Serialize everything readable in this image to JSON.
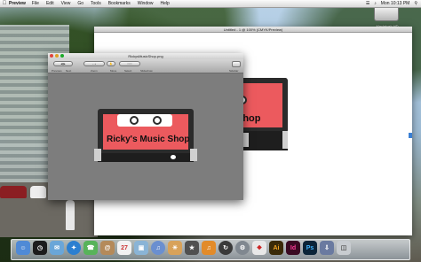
{
  "menubar": {
    "app": "Preview",
    "items": [
      "File",
      "Edit",
      "View",
      "Go",
      "Tools",
      "Bookmarks",
      "Window",
      "Help"
    ],
    "clock": "Mon 10:13 PM"
  },
  "desktop": {
    "icon_label": "Macintosh HD"
  },
  "back_window": {
    "title": "Untitled - 1 @ 100% (CMYK/Preview)"
  },
  "front_window": {
    "title": "RickysMusicShop.png",
    "toolbar": [
      "Previous",
      "Next",
      "Zoom",
      "Move",
      "Select",
      "Slideshow"
    ],
    "sidebar_label": "Sidebar"
  },
  "cassette": {
    "label": "Ricky's Music Shop",
    "label_partial": "Shop",
    "colors": {
      "body": "#ec5a5e",
      "frame": "#2b2b2b",
      "base": "#1e1e1e"
    }
  },
  "dock": {
    "items": [
      "finder-icon",
      "dashboard-icon",
      "mail-icon",
      "safari-icon",
      "ichat-icon",
      "addressbook-icon",
      "ical-icon",
      "preview-icon",
      "itunes-icon",
      "iphoto-icon",
      "imovie-icon",
      "garageband-icon",
      "timemachine-icon",
      "syspref-icon",
      "acrobat-icon",
      "illustrator-icon",
      "indesign-icon",
      "photoshop-icon",
      "downloads-icon",
      "trash-icon"
    ],
    "labels": {
      "illustrator": "Ai",
      "indesign": "Id",
      "photoshop": "Ps"
    }
  }
}
